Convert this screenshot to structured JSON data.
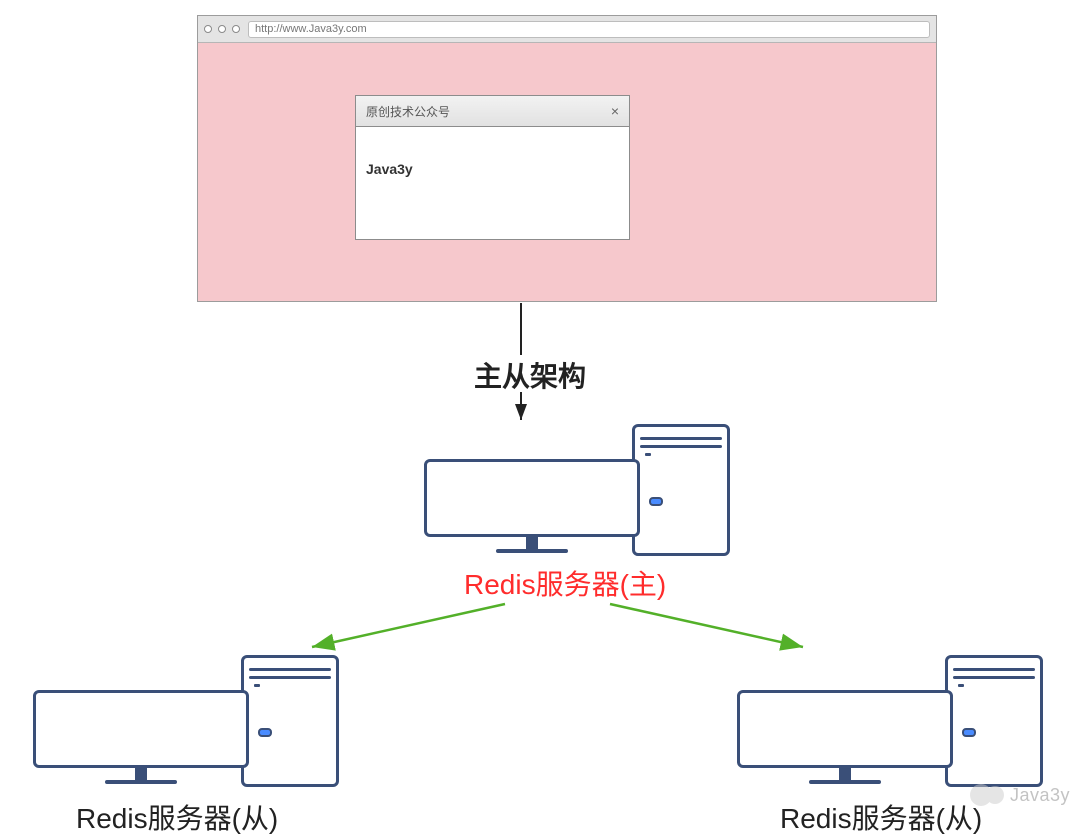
{
  "browser": {
    "url": "http://www.Java3y.com",
    "dialog_title": "原创技术公众号",
    "dialog_body": "Java3y",
    "dialog_close": "×"
  },
  "labels": {
    "architecture": "主从架构",
    "master": "Redis服务器(主)",
    "slave1": "Redis服务器(从)",
    "slave2": "Redis服务器(从)"
  },
  "watermark": "Java3y",
  "colors": {
    "browser_bg": "#f6c8cc",
    "line_fg": "#3a4f78",
    "arrow_green": "#53b029",
    "master_label": "#ff2c2c"
  }
}
